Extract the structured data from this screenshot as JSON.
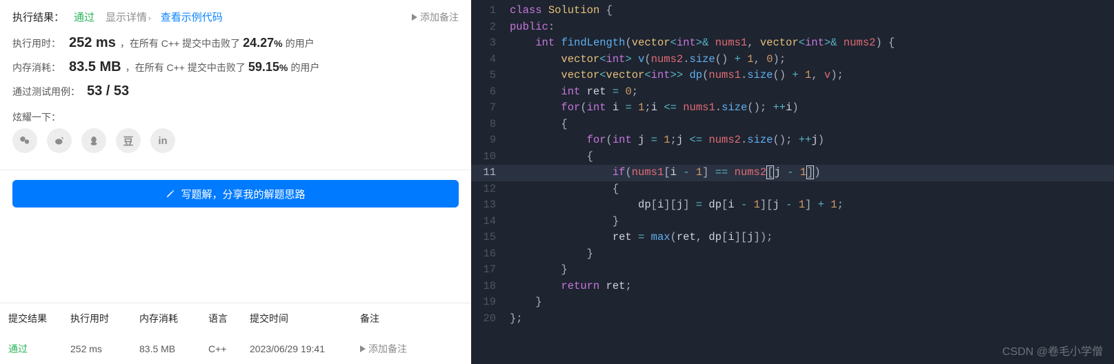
{
  "result": {
    "label": "执行结果：",
    "status": "通过",
    "show_detail": "显示详情",
    "example_link": "查看示例代码",
    "add_remark": "添加备注"
  },
  "runtime": {
    "label": "执行用时：",
    "value": "252 ms",
    "ctx_pre": "，在所有 C++ 提交中击败了",
    "pct": "24.27",
    "pct_sym": "%",
    "ctx_post": " 的用户"
  },
  "memory": {
    "label": "内存消耗：",
    "value": "83.5 MB",
    "ctx_pre": "，在所有 C++ 提交中击败了",
    "pct": "59.15",
    "pct_sym": "%",
    "ctx_post": " 的用户"
  },
  "testcases": {
    "label": "通过测试用例：",
    "value": "53 / 53"
  },
  "share": {
    "label": "炫耀一下：",
    "icons": [
      "wechat-icon",
      "weibo-icon",
      "qq-icon",
      "douban-icon",
      "linkedin-icon"
    ]
  },
  "write_solution": "写题解，分享我的解题思路",
  "table": {
    "headers": [
      "提交结果",
      "执行用时",
      "内存消耗",
      "语言",
      "提交时间",
      "备注"
    ],
    "row": {
      "status": "通过",
      "time_col": "252 ms",
      "mem_col": "83.5 MB",
      "lang": "C++",
      "ts": "2023/06/29 19:41",
      "remark": "添加备注"
    }
  },
  "code": {
    "highlightedLine": 11,
    "lines": [
      [
        [
          "kw",
          "class"
        ],
        [
          "var",
          " "
        ],
        [
          "type",
          "Solution"
        ],
        [
          "var",
          " "
        ],
        [
          "pun",
          "{"
        ]
      ],
      [
        [
          "kw",
          "public"
        ],
        [
          "pun",
          ":"
        ]
      ],
      [
        [
          "var",
          "    "
        ],
        [
          "kw",
          "int"
        ],
        [
          "var",
          " "
        ],
        [
          "fn",
          "findLength"
        ],
        [
          "pun",
          "("
        ],
        [
          "type",
          "vector"
        ],
        [
          "op",
          "<"
        ],
        [
          "kw",
          "int"
        ],
        [
          "op",
          ">&"
        ],
        [
          "var",
          " "
        ],
        [
          "id",
          "nums1"
        ],
        [
          "pun",
          ", "
        ],
        [
          "type",
          "vector"
        ],
        [
          "op",
          "<"
        ],
        [
          "kw",
          "int"
        ],
        [
          "op",
          ">&"
        ],
        [
          "var",
          " "
        ],
        [
          "id",
          "nums2"
        ],
        [
          "pun",
          ") {"
        ]
      ],
      [
        [
          "var",
          "        "
        ],
        [
          "type",
          "vector"
        ],
        [
          "op",
          "<"
        ],
        [
          "kw",
          "int"
        ],
        [
          "op",
          ">"
        ],
        [
          "var",
          " "
        ],
        [
          "fn",
          "v"
        ],
        [
          "pun",
          "("
        ],
        [
          "id",
          "nums2"
        ],
        [
          "pun",
          "."
        ],
        [
          "fn",
          "size"
        ],
        [
          "pun",
          "() "
        ],
        [
          "op",
          "+"
        ],
        [
          "var",
          " "
        ],
        [
          "num",
          "1"
        ],
        [
          "pun",
          ", "
        ],
        [
          "num",
          "0"
        ],
        [
          "pun",
          ");"
        ]
      ],
      [
        [
          "var",
          "        "
        ],
        [
          "type",
          "vector"
        ],
        [
          "op",
          "<"
        ],
        [
          "type",
          "vector"
        ],
        [
          "op",
          "<"
        ],
        [
          "kw",
          "int"
        ],
        [
          "op",
          ">>"
        ],
        [
          "var",
          " "
        ],
        [
          "fn",
          "dp"
        ],
        [
          "pun",
          "("
        ],
        [
          "id",
          "nums1"
        ],
        [
          "pun",
          "."
        ],
        [
          "fn",
          "size"
        ],
        [
          "pun",
          "() "
        ],
        [
          "op",
          "+"
        ],
        [
          "var",
          " "
        ],
        [
          "num",
          "1"
        ],
        [
          "pun",
          ", "
        ],
        [
          "id",
          "v"
        ],
        [
          "pun",
          ");"
        ]
      ],
      [
        [
          "var",
          "        "
        ],
        [
          "kw",
          "int"
        ],
        [
          "var",
          " ret "
        ],
        [
          "op",
          "="
        ],
        [
          "var",
          " "
        ],
        [
          "num",
          "0"
        ],
        [
          "pun",
          ";"
        ]
      ],
      [
        [
          "var",
          "        "
        ],
        [
          "kw",
          "for"
        ],
        [
          "pun",
          "("
        ],
        [
          "kw",
          "int"
        ],
        [
          "var",
          " i "
        ],
        [
          "op",
          "="
        ],
        [
          "var",
          " "
        ],
        [
          "num",
          "1"
        ],
        [
          "pun",
          ";"
        ],
        [
          "var",
          "i "
        ],
        [
          "op",
          "<="
        ],
        [
          "var",
          " "
        ],
        [
          "id",
          "nums1"
        ],
        [
          "pun",
          "."
        ],
        [
          "fn",
          "size"
        ],
        [
          "pun",
          "(); "
        ],
        [
          "op",
          "++"
        ],
        [
          "var",
          "i"
        ],
        [
          "pun",
          ")"
        ]
      ],
      [
        [
          "var",
          "        "
        ],
        [
          "pun",
          "{"
        ]
      ],
      [
        [
          "var",
          "            "
        ],
        [
          "kw",
          "for"
        ],
        [
          "pun",
          "("
        ],
        [
          "kw",
          "int"
        ],
        [
          "var",
          " j "
        ],
        [
          "op",
          "="
        ],
        [
          "var",
          " "
        ],
        [
          "num",
          "1"
        ],
        [
          "pun",
          ";"
        ],
        [
          "var",
          "j "
        ],
        [
          "op",
          "<="
        ],
        [
          "var",
          " "
        ],
        [
          "id",
          "nums2"
        ],
        [
          "pun",
          "."
        ],
        [
          "fn",
          "size"
        ],
        [
          "pun",
          "(); "
        ],
        [
          "op",
          "++"
        ],
        [
          "var",
          "j"
        ],
        [
          "pun",
          ")"
        ]
      ],
      [
        [
          "var",
          "            "
        ],
        [
          "pun",
          "{"
        ]
      ],
      [
        [
          "var",
          "                "
        ],
        [
          "kw",
          "if"
        ],
        [
          "pun",
          "("
        ],
        [
          "id",
          "nums1"
        ],
        [
          "pun",
          "["
        ],
        [
          "var",
          "i "
        ],
        [
          "op",
          "-"
        ],
        [
          "var",
          " "
        ],
        [
          "num",
          "1"
        ],
        [
          "pun",
          "] "
        ],
        [
          "op",
          "=="
        ],
        [
          "var",
          " "
        ],
        [
          "id",
          "nums2"
        ],
        [
          "cursorL",
          "["
        ],
        [
          "var",
          "j "
        ],
        [
          "op",
          "-"
        ],
        [
          "var",
          " "
        ],
        [
          "num",
          "1"
        ],
        [
          "cursorR",
          "]"
        ],
        [
          "pun",
          ")"
        ]
      ],
      [
        [
          "var",
          "                "
        ],
        [
          "pun",
          "{"
        ]
      ],
      [
        [
          "var",
          "                    "
        ],
        [
          "var",
          "dp"
        ],
        [
          "pun",
          "["
        ],
        [
          "var",
          "i"
        ],
        [
          "pun",
          "]["
        ],
        [
          "var",
          "j"
        ],
        [
          "pun",
          "] "
        ],
        [
          "op",
          "="
        ],
        [
          "var",
          " dp"
        ],
        [
          "pun",
          "["
        ],
        [
          "var",
          "i "
        ],
        [
          "op",
          "-"
        ],
        [
          "var",
          " "
        ],
        [
          "num",
          "1"
        ],
        [
          "pun",
          "]["
        ],
        [
          "var",
          "j "
        ],
        [
          "op",
          "-"
        ],
        [
          "var",
          " "
        ],
        [
          "num",
          "1"
        ],
        [
          "pun",
          "] "
        ],
        [
          "op",
          "+"
        ],
        [
          "var",
          " "
        ],
        [
          "num",
          "1"
        ],
        [
          "pun",
          ";"
        ]
      ],
      [
        [
          "var",
          "                "
        ],
        [
          "pun",
          "}"
        ]
      ],
      [
        [
          "var",
          "                ret "
        ],
        [
          "op",
          "="
        ],
        [
          "var",
          " "
        ],
        [
          "fn",
          "max"
        ],
        [
          "pun",
          "("
        ],
        [
          "var",
          "ret"
        ],
        [
          "pun",
          ", "
        ],
        [
          "var",
          "dp"
        ],
        [
          "pun",
          "["
        ],
        [
          "var",
          "i"
        ],
        [
          "pun",
          "]["
        ],
        [
          "var",
          "j"
        ],
        [
          "pun",
          "]);"
        ]
      ],
      [
        [
          "var",
          "            "
        ],
        [
          "pun",
          "}"
        ]
      ],
      [
        [
          "var",
          "        "
        ],
        [
          "pun",
          "}"
        ]
      ],
      [
        [
          "var",
          "        "
        ],
        [
          "kw",
          "return"
        ],
        [
          "var",
          " ret"
        ],
        [
          "pun",
          ";"
        ]
      ],
      [
        [
          "var",
          "    "
        ],
        [
          "pun",
          "}"
        ]
      ],
      [
        [
          "pun",
          "};"
        ]
      ]
    ]
  },
  "watermark": "CSDN @卷毛小学僧"
}
